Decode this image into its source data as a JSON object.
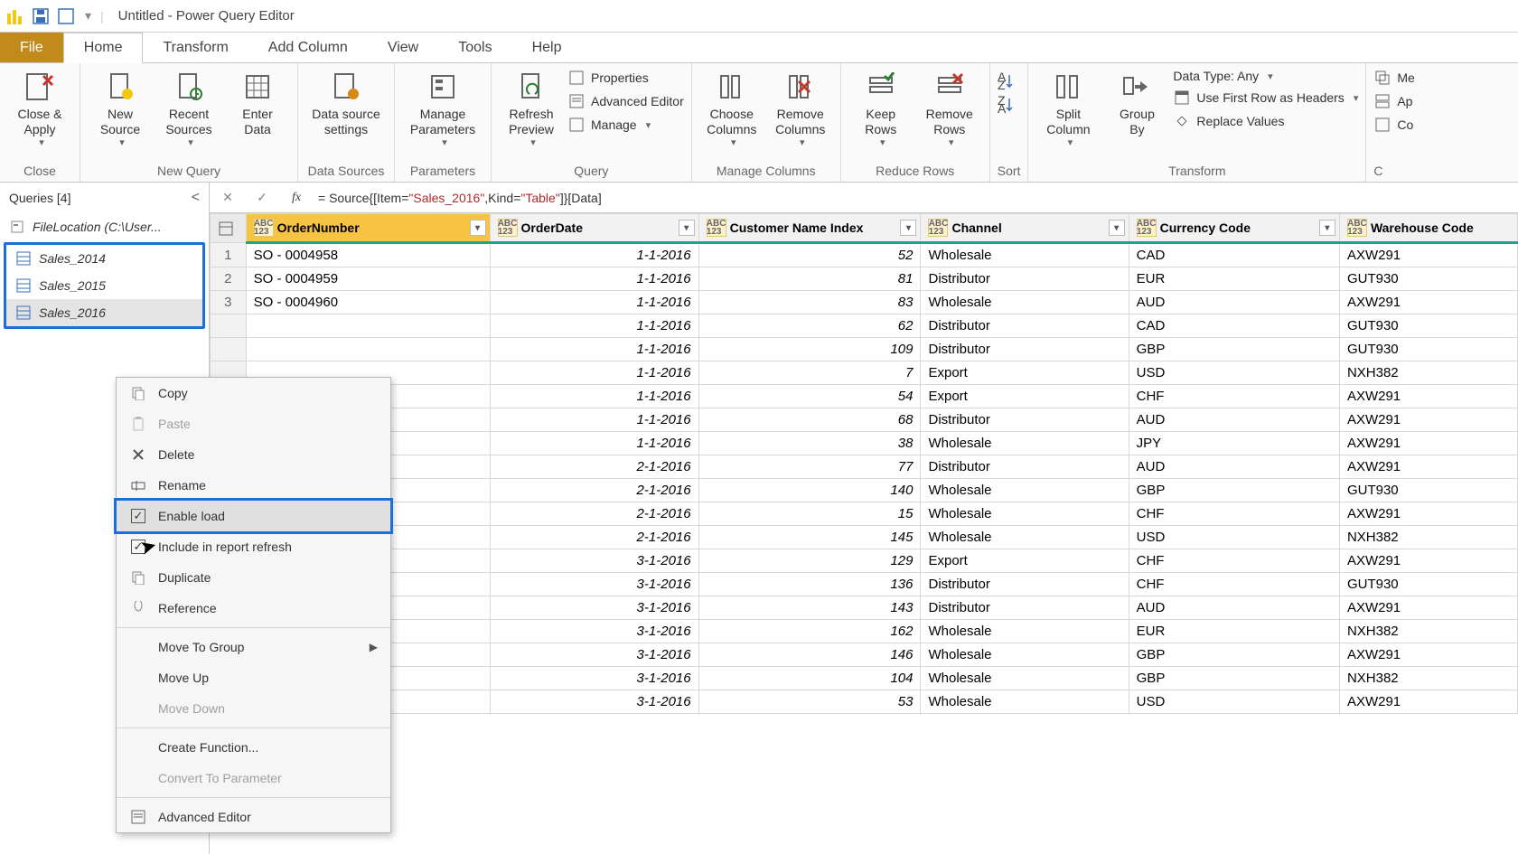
{
  "titlebar": {
    "title": "Untitled - Power Query Editor"
  },
  "menutabs": {
    "file": "File",
    "home": "Home",
    "transform": "Transform",
    "addcol": "Add Column",
    "view": "View",
    "tools": "Tools",
    "help": "Help"
  },
  "ribbon": {
    "close": {
      "close_apply": "Close &\nApply",
      "group": "Close"
    },
    "newquery": {
      "new_source": "New\nSource",
      "recent_sources": "Recent\nSources",
      "enter_data": "Enter\nData",
      "group": "New Query"
    },
    "datasrc": {
      "settings": "Data source\nsettings",
      "group": "Data Sources"
    },
    "params": {
      "manage": "Manage\nParameters",
      "group": "Parameters"
    },
    "query": {
      "refresh": "Refresh\nPreview",
      "properties": "Properties",
      "adv": "Advanced Editor",
      "manage": "Manage",
      "group": "Query"
    },
    "managecols": {
      "choose": "Choose\nColumns",
      "remove": "Remove\nColumns",
      "group": "Manage Columns"
    },
    "reducerows": {
      "keep": "Keep\nRows",
      "remove": "Remove\nRows",
      "group": "Reduce Rows"
    },
    "sort": {
      "group": "Sort"
    },
    "transform": {
      "split": "Split\nColumn",
      "groupby": "Group\nBy",
      "datatype": "Data Type: Any",
      "firstrow": "Use First Row as Headers",
      "replace": "Replace Values",
      "group": "Transform"
    },
    "combine": {
      "merge": "Me",
      "append": "Ap",
      "combinefiles": "Co"
    }
  },
  "sidebar": {
    "header": "Queries [4]",
    "filelocation": "FileLocation (C:\\User...",
    "q1": "Sales_2014",
    "q2": "Sales_2015",
    "q3": "Sales_2016"
  },
  "formula": {
    "prefix": "= Source{[Item=",
    "s1": "\"Sales_2016\"",
    "mid": ",Kind=",
    "s2": "\"Table\"",
    "suffix": "]}[Data]"
  },
  "columns": {
    "c0": "OrderNumber",
    "c1": "OrderDate",
    "c2": "Customer Name Index",
    "c3": "Channel",
    "c4": "Currency Code",
    "c5": "Warehouse Code",
    "type": "ABC\n123"
  },
  "rows": [
    {
      "n": "1",
      "a": "SO - 0004958",
      "b": "1-1-2016",
      "c": "52",
      "d": "Wholesale",
      "e": "CAD",
      "f": "AXW291"
    },
    {
      "n": "2",
      "a": "SO - 0004959",
      "b": "1-1-2016",
      "c": "81",
      "d": "Distributor",
      "e": "EUR",
      "f": "GUT930"
    },
    {
      "n": "3",
      "a": "SO - 0004960",
      "b": "1-1-2016",
      "c": "83",
      "d": "Wholesale",
      "e": "AUD",
      "f": "AXW291"
    },
    {
      "n": "",
      "a": "",
      "b": "1-1-2016",
      "c": "62",
      "d": "Distributor",
      "e": "CAD",
      "f": "GUT930"
    },
    {
      "n": "",
      "a": "",
      "b": "1-1-2016",
      "c": "109",
      "d": "Distributor",
      "e": "GBP",
      "f": "GUT930"
    },
    {
      "n": "",
      "a": "",
      "b": "1-1-2016",
      "c": "7",
      "d": "Export",
      "e": "USD",
      "f": "NXH382"
    },
    {
      "n": "",
      "a": "",
      "b": "1-1-2016",
      "c": "54",
      "d": "Export",
      "e": "CHF",
      "f": "AXW291"
    },
    {
      "n": "",
      "a": "",
      "b": "1-1-2016",
      "c": "68",
      "d": "Distributor",
      "e": "AUD",
      "f": "AXW291"
    },
    {
      "n": "",
      "a": "",
      "b": "1-1-2016",
      "c": "38",
      "d": "Wholesale",
      "e": "JPY",
      "f": "AXW291"
    },
    {
      "n": "",
      "a": "",
      "b": "2-1-2016",
      "c": "77",
      "d": "Distributor",
      "e": "AUD",
      "f": "AXW291"
    },
    {
      "n": "",
      "a": "",
      "b": "2-1-2016",
      "c": "140",
      "d": "Wholesale",
      "e": "GBP",
      "f": "GUT930"
    },
    {
      "n": "",
      "a": "",
      "b": "2-1-2016",
      "c": "15",
      "d": "Wholesale",
      "e": "CHF",
      "f": "AXW291"
    },
    {
      "n": "",
      "a": "",
      "b": "2-1-2016",
      "c": "145",
      "d": "Wholesale",
      "e": "USD",
      "f": "NXH382"
    },
    {
      "n": "",
      "a": "",
      "b": "3-1-2016",
      "c": "129",
      "d": "Export",
      "e": "CHF",
      "f": "AXW291"
    },
    {
      "n": "",
      "a": "",
      "b": "3-1-2016",
      "c": "136",
      "d": "Distributor",
      "e": "CHF",
      "f": "GUT930"
    },
    {
      "n": "",
      "a": "",
      "b": "3-1-2016",
      "c": "143",
      "d": "Distributor",
      "e": "AUD",
      "f": "AXW291"
    },
    {
      "n": "",
      "a": "",
      "b": "3-1-2016",
      "c": "162",
      "d": "Wholesale",
      "e": "EUR",
      "f": "NXH382"
    },
    {
      "n": "",
      "a": "",
      "b": "3-1-2016",
      "c": "146",
      "d": "Wholesale",
      "e": "GBP",
      "f": "AXW291"
    },
    {
      "n": "",
      "a": "",
      "b": "3-1-2016",
      "c": "104",
      "d": "Wholesale",
      "e": "GBP",
      "f": "NXH382"
    },
    {
      "n": "",
      "a": "",
      "b": "3-1-2016",
      "c": "53",
      "d": "Wholesale",
      "e": "USD",
      "f": "AXW291"
    }
  ],
  "ctx": {
    "copy": "Copy",
    "paste": "Paste",
    "delete": "Delete",
    "rename": "Rename",
    "enable_load": "Enable load",
    "include_refresh": "Include in report refresh",
    "duplicate": "Duplicate",
    "reference": "Reference",
    "move_group": "Move To Group",
    "move_up": "Move Up",
    "move_down": "Move Down",
    "create_fn": "Create Function...",
    "convert_param": "Convert To Parameter",
    "adv_editor": "Advanced Editor"
  }
}
